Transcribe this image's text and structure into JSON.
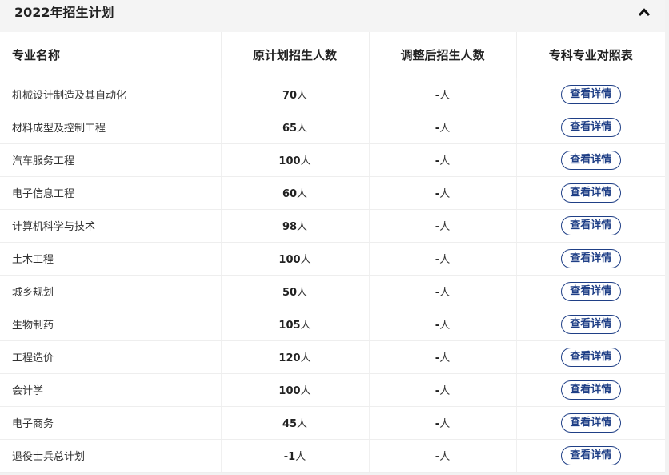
{
  "header": {
    "title": "2022年招生计划"
  },
  "table": {
    "columns": [
      "专业名称",
      "原计划招生人数",
      "调整后招生人数",
      "专科专业对照表"
    ],
    "unit": "人",
    "button_label": "查看详情",
    "rows": [
      {
        "name": "机械设计制造及其自动化",
        "planned": "70",
        "adjusted": "-"
      },
      {
        "name": "材料成型及控制工程",
        "planned": "65",
        "adjusted": "-"
      },
      {
        "name": "汽车服务工程",
        "planned": "100",
        "adjusted": "-"
      },
      {
        "name": "电子信息工程",
        "planned": "60",
        "adjusted": "-"
      },
      {
        "name": "计算机科学与技术",
        "planned": "98",
        "adjusted": "-"
      },
      {
        "name": "土木工程",
        "planned": "100",
        "adjusted": "-"
      },
      {
        "name": "城乡规划",
        "planned": "50",
        "adjusted": "-"
      },
      {
        "name": "生物制药",
        "planned": "105",
        "adjusted": "-"
      },
      {
        "name": "工程造价",
        "planned": "120",
        "adjusted": "-"
      },
      {
        "name": "会计学",
        "planned": "100",
        "adjusted": "-"
      },
      {
        "name": "电子商务",
        "planned": "45",
        "adjusted": "-"
      },
      {
        "name": "退役士兵总计划",
        "planned": "-1",
        "adjusted": "-"
      }
    ]
  },
  "colors": {
    "accent": "#1f3f86",
    "header_bg": "#f4f4f4",
    "row_border": "#eeeeee"
  },
  "icons": {
    "collapse": "chevron-up-icon"
  }
}
